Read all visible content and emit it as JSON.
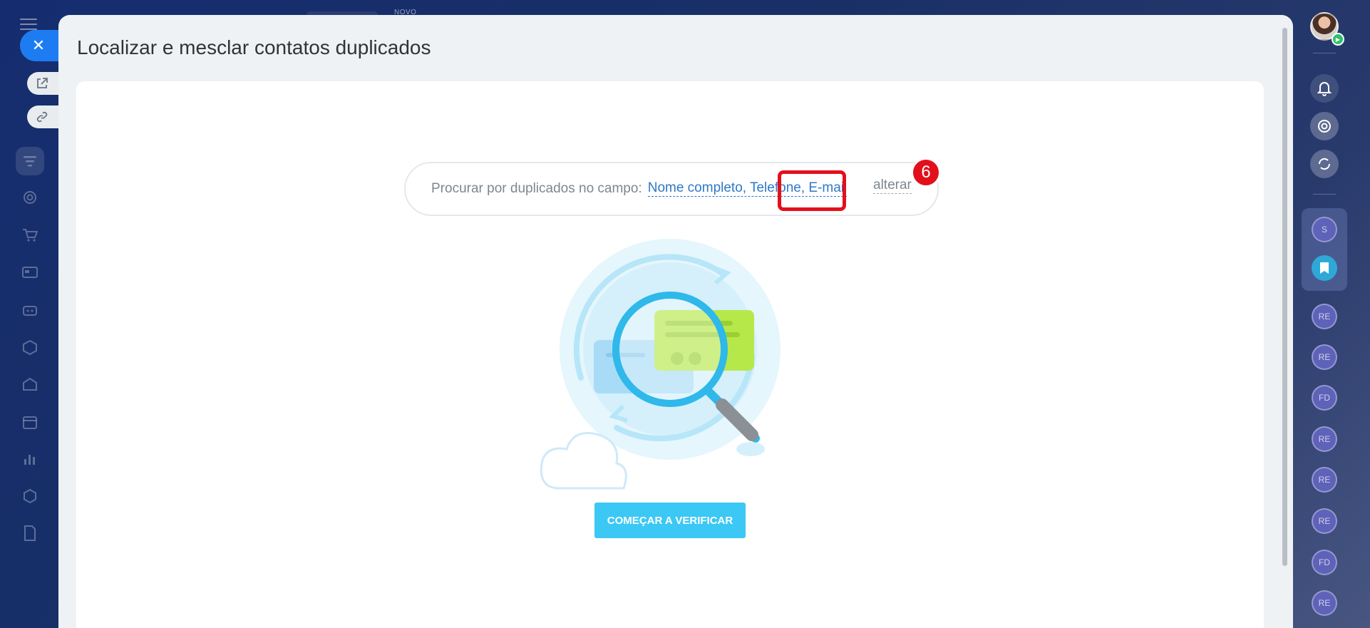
{
  "slider": {
    "title": "Localizar e mesclar contatos duplicados"
  },
  "search": {
    "prompt": "Procurar por duplicados no campo:",
    "fields": "Nome completo, Telefone, E-mail",
    "change_label": "alterar"
  },
  "callout": {
    "number": "6",
    "color": "#e3101c"
  },
  "start_button": {
    "label": "COMEÇAR A VERIFICAR",
    "color": "#3bc8f5"
  },
  "top_bar": {
    "new_label": "NOVO"
  },
  "left_sidebar": {
    "icons": [
      "menu-icon",
      "funnel-icon",
      "target-icon",
      "cart-icon",
      "contact-card-icon",
      "robot-icon",
      "box-icon",
      "warehouse-icon",
      "calendar-icon",
      "chart-icon",
      "settings-icon",
      "document-icon"
    ]
  },
  "slider_actions": {
    "icons": [
      "close-icon",
      "open-in-new-window-icon",
      "link-icon"
    ]
  },
  "right_sidebar": {
    "icons": [
      "avatar",
      "bell-icon",
      "copilot-icon",
      "refresh-chat-icon",
      "bookmark-icon"
    ],
    "chips": [
      {
        "label": "S"
      },
      {
        "label": "RE"
      },
      {
        "label": "RE"
      },
      {
        "label": "FD"
      },
      {
        "label": "RE"
      },
      {
        "label": "RE"
      },
      {
        "label": "RE"
      },
      {
        "label": "FD"
      },
      {
        "label": "RE"
      }
    ]
  }
}
